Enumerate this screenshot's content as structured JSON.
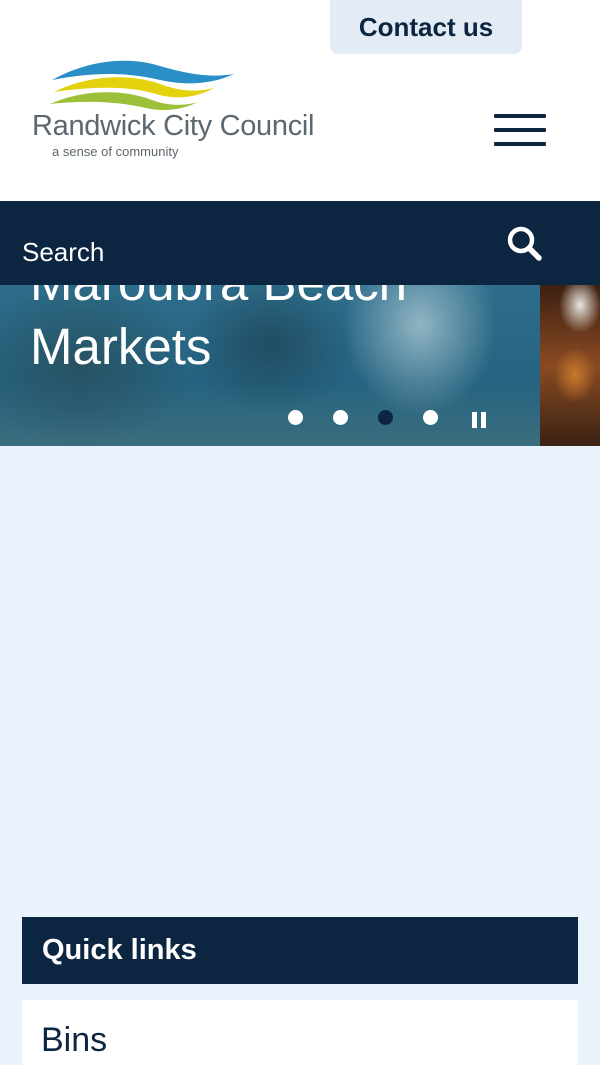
{
  "header": {
    "contact_label": "Contact us",
    "logo": {
      "name": "Randwick City Council",
      "tagline": "a sense of community",
      "colors": {
        "blue": "#2a8fc6",
        "yellow": "#e4d20f",
        "green": "#9dc03a"
      }
    },
    "menu_icon": "hamburger-menu-icon"
  },
  "search": {
    "placeholder": "Search",
    "icon": "search-icon"
  },
  "hero": {
    "title": "Maroubra Beach Markets",
    "slides_count": 4,
    "active_slide": 3,
    "pause_icon": "pause-icon"
  },
  "quick_links": {
    "heading": "Quick links",
    "items": [
      {
        "label": "Bins"
      }
    ]
  },
  "colors": {
    "navy": "#0c2540",
    "page_background": "#eaf3fc",
    "contact_button": "#e3ecf4"
  }
}
